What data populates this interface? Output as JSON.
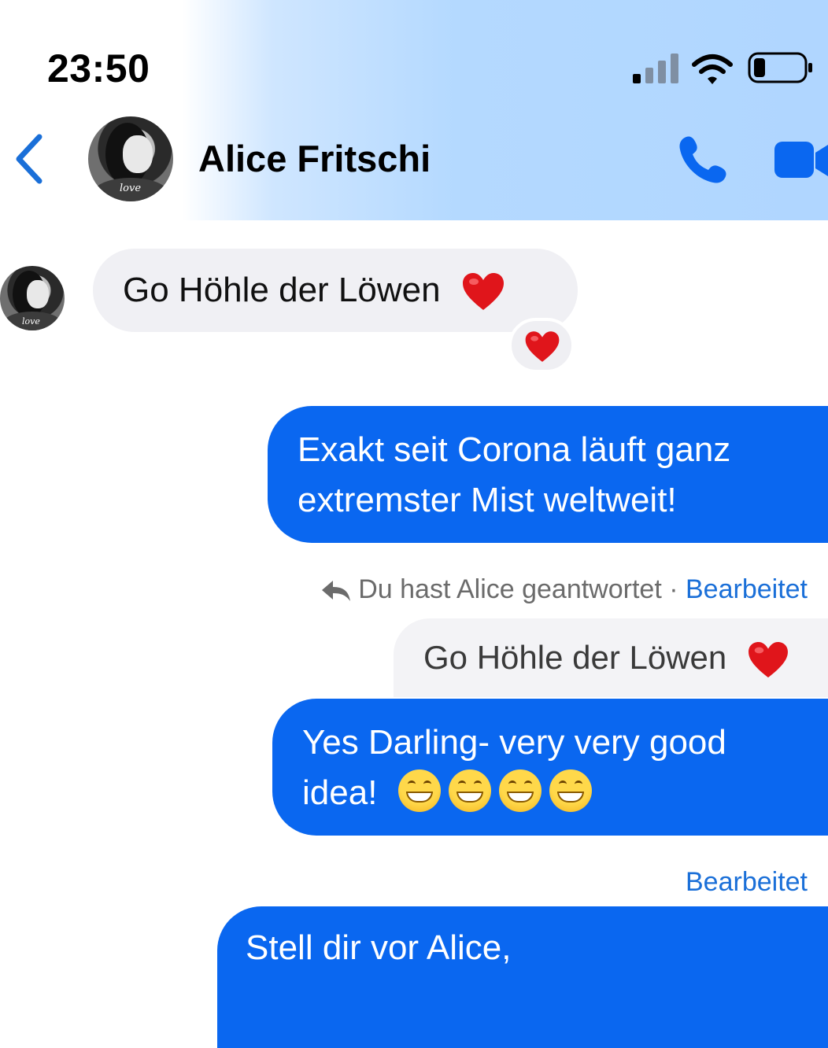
{
  "status_bar": {
    "time": "23:50"
  },
  "header": {
    "contact_name": "Alice Fritschi",
    "avatar_caption": "love"
  },
  "messages": {
    "incoming_1": {
      "text": "Go Höhle der Löwen"
    },
    "outgoing_1": {
      "line1": "Exakt seit Corona läuft ganz",
      "line2": "extremster Mist weltweit!"
    },
    "reply_info": {
      "text": "Du hast Alice geantwortet",
      "separator": " · ",
      "edited": "Bearbeitet"
    },
    "quoted": {
      "text": "Go Höhle der Löwen"
    },
    "outgoing_2": {
      "line1": "Yes Darling- very very good",
      "line2": "idea!"
    },
    "edited_2": "Bearbeitet",
    "outgoing_3": {
      "text": "Stell dir vor Alice,"
    }
  },
  "colors": {
    "accent": "#0a67f0",
    "link": "#1a6fd8",
    "heart": "#e0151b"
  }
}
